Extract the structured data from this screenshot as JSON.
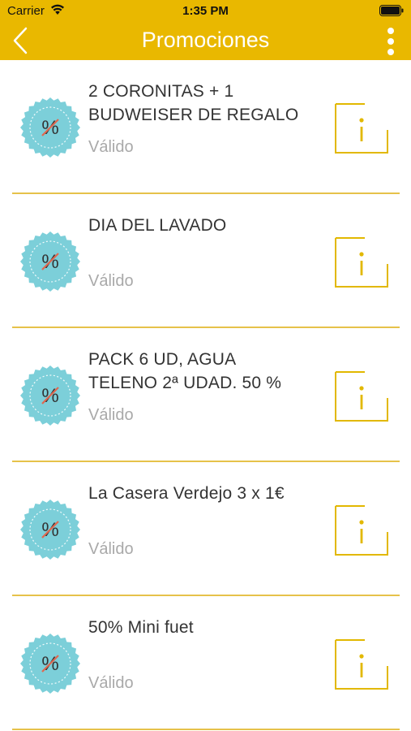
{
  "status_bar": {
    "carrier": "Carrier",
    "time": "1:35 PM"
  },
  "nav": {
    "title": "Promociones",
    "back_icon": "chevron-left-icon",
    "more_icon": "more-vertical-icon"
  },
  "colors": {
    "header": "#e9b800",
    "badge": "#7ccfd9",
    "badge_percent": "#e0674f",
    "info_icon": "#e2b800",
    "divider": "#e6c24a"
  },
  "promotions": [
    {
      "title_lines": [
        "2 CORONITAS + 1",
        "BUDWEISER DE REGALO"
      ],
      "status": "Válido"
    },
    {
      "title_lines": [
        "DIA DEL LAVADO"
      ],
      "status": "Válido"
    },
    {
      "title_lines": [
        "PACK 6 UD, AGUA",
        "TELENO 2ª UDAD. 50 %"
      ],
      "status": "Válido"
    },
    {
      "title_lines": [
        "La Casera  Verdejo 3 x 1€"
      ],
      "status": "Válido"
    },
    {
      "title_lines": [
        "50% Mini fuet"
      ],
      "status": "Válido"
    }
  ]
}
